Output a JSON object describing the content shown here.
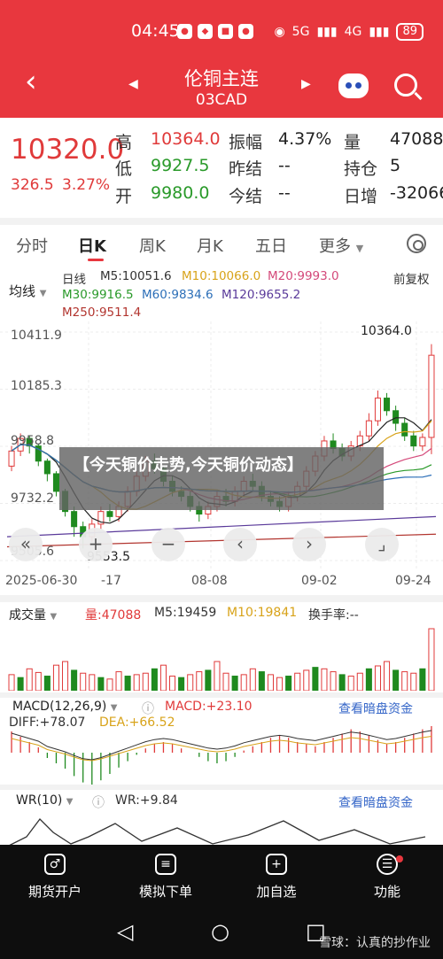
{
  "status_bar": {
    "time": "04:45",
    "network_label": "4G",
    "signal_label": "5G",
    "battery": "89"
  },
  "nav": {
    "title": "伦铜主连",
    "subtitle": "03CAD"
  },
  "quote": {
    "price": "10320.0",
    "change": "326.5",
    "change_pct": "3.27%",
    "fields": [
      {
        "label": "高",
        "value": "10364.0",
        "color": "#e03a3a"
      },
      {
        "label": "低",
        "value": "9927.5",
        "color": "#2a9a2a"
      },
      {
        "label": "开",
        "value": "9980.0",
        "color": "#2a9a2a"
      },
      {
        "label": "振幅",
        "value": "4.37%",
        "color": "#222222"
      },
      {
        "label": "昨结",
        "value": "--",
        "color": "#222222"
      },
      {
        "label": "今结",
        "value": "--",
        "color": "#222222"
      },
      {
        "label": "量",
        "value": "47088",
        "color": "#222222"
      },
      {
        "label": "持仓",
        "value": "5",
        "color": "#222222"
      },
      {
        "label": "日增",
        "value": "-32066",
        "color": "#222222"
      }
    ]
  },
  "tabs": [
    "分时",
    "日K",
    "周K",
    "月K",
    "五日",
    "更多"
  ],
  "active_tab": "日K",
  "indicators": {
    "ma_button": "均线",
    "day_label": "日线",
    "ma5": "M5:10051.6",
    "ma10": "M10:10066.0",
    "ma20": "M20:9993.0",
    "restore": "前复权",
    "ma30": "M30:9916.5",
    "ma60": "M60:9834.6",
    "ma120": "M120:9655.2",
    "ma250": "M250:9511.4"
  },
  "chart_data": {
    "type": "candlestick",
    "y_ticks": [
      "10411.9",
      "10185.3",
      "9958.8",
      "9732.2",
      "9505.6"
    ],
    "x_ticks": [
      "2025-06-30",
      "-17",
      "08-08",
      "09-02",
      "09-24"
    ],
    "max_label": "10364.0",
    "min_label": "9553.5",
    "ylim": [
      9505.6,
      10411.9
    ],
    "candles": [
      {
        "o": 9880,
        "c": 9940,
        "h": 9960,
        "l": 9860
      },
      {
        "o": 9940,
        "c": 9990,
        "h": 10010,
        "l": 9920
      },
      {
        "o": 9990,
        "c": 9960,
        "h": 10000,
        "l": 9930
      },
      {
        "o": 9960,
        "c": 9900,
        "h": 9970,
        "l": 9880
      },
      {
        "o": 9900,
        "c": 9850,
        "h": 9910,
        "l": 9820
      },
      {
        "o": 9850,
        "c": 9780,
        "h": 9860,
        "l": 9760
      },
      {
        "o": 9780,
        "c": 9700,
        "h": 9790,
        "l": 9680
      },
      {
        "o": 9700,
        "c": 9640,
        "h": 9720,
        "l": 9600
      },
      {
        "o": 9640,
        "c": 9600,
        "h": 9660,
        "l": 9553.5
      },
      {
        "o": 9600,
        "c": 9650,
        "h": 9670,
        "l": 9580
      },
      {
        "o": 9650,
        "c": 9700,
        "h": 9720,
        "l": 9630
      },
      {
        "o": 9700,
        "c": 9680,
        "h": 9730,
        "l": 9660
      },
      {
        "o": 9680,
        "c": 9720,
        "h": 9740,
        "l": 9660
      },
      {
        "o": 9720,
        "c": 9780,
        "h": 9800,
        "l": 9700
      },
      {
        "o": 9780,
        "c": 9840,
        "h": 9860,
        "l": 9760
      },
      {
        "o": 9840,
        "c": 9900,
        "h": 9920,
        "l": 9820
      },
      {
        "o": 9900,
        "c": 9870,
        "h": 9930,
        "l": 9850
      },
      {
        "o": 9870,
        "c": 9820,
        "h": 9880,
        "l": 9800
      },
      {
        "o": 9820,
        "c": 9780,
        "h": 9840,
        "l": 9760
      },
      {
        "o": 9780,
        "c": 9760,
        "h": 9800,
        "l": 9740
      },
      {
        "o": 9760,
        "c": 9720,
        "h": 9780,
        "l": 9700
      },
      {
        "o": 9720,
        "c": 9690,
        "h": 9740,
        "l": 9660
      },
      {
        "o": 9690,
        "c": 9720,
        "h": 9740,
        "l": 9670
      },
      {
        "o": 9720,
        "c": 9760,
        "h": 9780,
        "l": 9700
      },
      {
        "o": 9760,
        "c": 9740,
        "h": 9790,
        "l": 9720
      },
      {
        "o": 9740,
        "c": 9780,
        "h": 9800,
        "l": 9720
      },
      {
        "o": 9780,
        "c": 9820,
        "h": 9840,
        "l": 9760
      },
      {
        "o": 9820,
        "c": 9800,
        "h": 9850,
        "l": 9780
      },
      {
        "o": 9800,
        "c": 9760,
        "h": 9820,
        "l": 9740
      },
      {
        "o": 9760,
        "c": 9740,
        "h": 9780,
        "l": 9720
      },
      {
        "o": 9740,
        "c": 9720,
        "h": 9760,
        "l": 9700
      },
      {
        "o": 9720,
        "c": 9760,
        "h": 9780,
        "l": 9700
      },
      {
        "o": 9760,
        "c": 9800,
        "h": 9820,
        "l": 9740
      },
      {
        "o": 9800,
        "c": 9860,
        "h": 9880,
        "l": 9780
      },
      {
        "o": 9860,
        "c": 9920,
        "h": 9940,
        "l": 9840
      },
      {
        "o": 9920,
        "c": 9980,
        "h": 10000,
        "l": 9900
      },
      {
        "o": 9980,
        "c": 9950,
        "h": 10010,
        "l": 9930
      },
      {
        "o": 9950,
        "c": 9920,
        "h": 9970,
        "l": 9900
      },
      {
        "o": 9920,
        "c": 9960,
        "h": 9980,
        "l": 9900
      },
      {
        "o": 9960,
        "c": 10000,
        "h": 10020,
        "l": 9940
      },
      {
        "o": 10000,
        "c": 10060,
        "h": 10090,
        "l": 9980
      },
      {
        "o": 10060,
        "c": 10150,
        "h": 10180,
        "l": 10040
      },
      {
        "o": 10150,
        "c": 10100,
        "h": 10170,
        "l": 10080
      },
      {
        "o": 10100,
        "c": 10050,
        "h": 10120,
        "l": 10020
      },
      {
        "o": 10050,
        "c": 10000,
        "h": 10070,
        "l": 9980
      },
      {
        "o": 10000,
        "c": 9960,
        "h": 10020,
        "l": 9940
      },
      {
        "o": 9960,
        "c": 9994,
        "h": 10010,
        "l": 9940
      },
      {
        "o": 9994,
        "c": 10320,
        "h": 10364,
        "l": 9927.5
      }
    ]
  },
  "volume_panel": {
    "title": "成交量",
    "vol": "量:47088",
    "m5": "M5:19459",
    "m10": "M10:19841",
    "turnover": "换手率:--",
    "values": [
      22,
      18,
      30,
      25,
      20,
      35,
      40,
      28,
      24,
      22,
      18,
      16,
      26,
      20,
      22,
      24,
      30,
      35,
      20,
      18,
      22,
      26,
      28,
      40,
      24,
      20,
      22,
      30,
      26,
      22,
      18,
      20,
      24,
      28,
      32,
      30,
      26,
      22,
      20,
      24,
      30,
      34,
      40,
      28,
      26,
      24,
      30,
      85
    ]
  },
  "macd_panel": {
    "title": "MACD(12,26,9)",
    "macd": "MACD:+23.10",
    "diff": "DIFF:+78.07",
    "dea": "DEA:+66.52",
    "link": "查看暗盘资金",
    "values": [
      20,
      15,
      10,
      5,
      -5,
      -10,
      -15,
      -22,
      -28,
      -30,
      -26,
      -20,
      -14,
      -8,
      -2,
      4,
      8,
      10,
      8,
      4,
      0,
      -4,
      -8,
      -10,
      -8,
      -4,
      2,
      6,
      10,
      14,
      16,
      14,
      10,
      8,
      6,
      10,
      14,
      18,
      22,
      20,
      16,
      12,
      8,
      10,
      14,
      18,
      22,
      25
    ]
  },
  "wr_panel": {
    "title": "WR(10)",
    "wr": "WR:+9.84",
    "link": "查看暗盘资金"
  },
  "overlay": {
    "text": "【今天铜价走势,今天铜价动态】"
  },
  "bottom_bar": {
    "items": [
      {
        "label": "期货开户",
        "icon": "♂"
      },
      {
        "label": "模拟下单",
        "icon": "≡"
      },
      {
        "label": "加自选",
        "icon": "+"
      },
      {
        "label": "功能",
        "icon": "☰"
      }
    ],
    "watermark": "雪球：认真的抄作业"
  },
  "colors": {
    "up": "#e03a3a",
    "down": "#1f8a1f",
    "brand": "#e8373e"
  }
}
